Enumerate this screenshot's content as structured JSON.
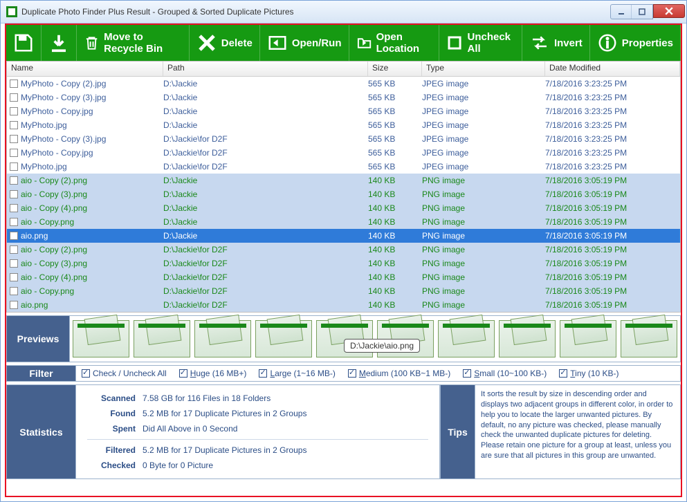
{
  "titlebar": {
    "text": "Duplicate Photo Finder Plus Result - Grouped & Sorted Duplicate Pictures"
  },
  "toolbar": {
    "recycle": "Move to Recycle Bin",
    "delete": "Delete",
    "open": "Open/Run",
    "location": "Open Location",
    "uncheck": "Uncheck All",
    "invert": "Invert",
    "properties": "Properties"
  },
  "columns": {
    "name": "Name",
    "path": "Path",
    "size": "Size",
    "type": "Type",
    "date": "Date Modified"
  },
  "rows": [
    {
      "g": 0,
      "name": "MyPhoto - Copy (2).jpg",
      "path": "D:\\Jackie",
      "size": "565 KB",
      "type": "JPEG image",
      "date": "7/18/2016 3:23:25 PM"
    },
    {
      "g": 0,
      "name": "MyPhoto - Copy (3).jpg",
      "path": "D:\\Jackie",
      "size": "565 KB",
      "type": "JPEG image",
      "date": "7/18/2016 3:23:25 PM"
    },
    {
      "g": 0,
      "name": "MyPhoto - Copy.jpg",
      "path": "D:\\Jackie",
      "size": "565 KB",
      "type": "JPEG image",
      "date": "7/18/2016 3:23:25 PM"
    },
    {
      "g": 0,
      "name": "MyPhoto.jpg",
      "path": "D:\\Jackie",
      "size": "565 KB",
      "type": "JPEG image",
      "date": "7/18/2016 3:23:25 PM"
    },
    {
      "g": 0,
      "name": "MyPhoto - Copy (3).jpg",
      "path": "D:\\Jackie\\for D2F",
      "size": "565 KB",
      "type": "JPEG image",
      "date": "7/18/2016 3:23:25 PM"
    },
    {
      "g": 0,
      "name": "MyPhoto - Copy.jpg",
      "path": "D:\\Jackie\\for D2F",
      "size": "565 KB",
      "type": "JPEG image",
      "date": "7/18/2016 3:23:25 PM"
    },
    {
      "g": 0,
      "name": "MyPhoto.jpg",
      "path": "D:\\Jackie\\for D2F",
      "size": "565 KB",
      "type": "JPEG image",
      "date": "7/18/2016 3:23:25 PM"
    },
    {
      "g": 1,
      "name": "aio - Copy (2).png",
      "path": "D:\\Jackie",
      "size": "140 KB",
      "type": "PNG image",
      "date": "7/18/2016 3:05:19 PM"
    },
    {
      "g": 1,
      "name": "aio - Copy (3).png",
      "path": "D:\\Jackie",
      "size": "140 KB",
      "type": "PNG image",
      "date": "7/18/2016 3:05:19 PM"
    },
    {
      "g": 1,
      "name": "aio - Copy (4).png",
      "path": "D:\\Jackie",
      "size": "140 KB",
      "type": "PNG image",
      "date": "7/18/2016 3:05:19 PM"
    },
    {
      "g": 1,
      "name": "aio - Copy.png",
      "path": "D:\\Jackie",
      "size": "140 KB",
      "type": "PNG image",
      "date": "7/18/2016 3:05:19 PM"
    },
    {
      "g": 1,
      "sel": true,
      "name": "aio.png",
      "path": "D:\\Jackie",
      "size": "140 KB",
      "type": "PNG image",
      "date": "7/18/2016 3:05:19 PM"
    },
    {
      "g": 1,
      "name": "aio - Copy (2).png",
      "path": "D:\\Jackie\\for D2F",
      "size": "140 KB",
      "type": "PNG image",
      "date": "7/18/2016 3:05:19 PM"
    },
    {
      "g": 1,
      "name": "aio - Copy (3).png",
      "path": "D:\\Jackie\\for D2F",
      "size": "140 KB",
      "type": "PNG image",
      "date": "7/18/2016 3:05:19 PM"
    },
    {
      "g": 1,
      "name": "aio - Copy (4).png",
      "path": "D:\\Jackie\\for D2F",
      "size": "140 KB",
      "type": "PNG image",
      "date": "7/18/2016 3:05:19 PM"
    },
    {
      "g": 1,
      "name": "aio - Copy.png",
      "path": "D:\\Jackie\\for D2F",
      "size": "140 KB",
      "type": "PNG image",
      "date": "7/18/2016 3:05:19 PM"
    },
    {
      "g": 1,
      "name": "aio.png",
      "path": "D:\\Jackie\\for D2F",
      "size": "140 KB",
      "type": "PNG image",
      "date": "7/18/2016 3:05:19 PM"
    }
  ],
  "tooltip": "D:\\Jackie\\aio.png",
  "panels": {
    "previews": "Previews",
    "filter": "Filter",
    "statistics": "Statistics",
    "tips": "Tips"
  },
  "filter": {
    "checkall": "Check / Uncheck All",
    "huge": "Huge (16 MB+)",
    "large": "Large (1~16 MB-)",
    "medium": "Medium (100 KB~1 MB-)",
    "small": "Small (10~100 KB-)",
    "tiny": "Tiny (10 KB-)"
  },
  "stats": {
    "scanned_lbl": "Scanned",
    "scanned": "7.58 GB for 116 Files in 18 Folders",
    "found_lbl": "Found",
    "found": "5.2 MB for 17 Duplicate Pictures in 2 Groups",
    "spent_lbl": "Spent",
    "spent": "Did All Above in 0 Second",
    "filtered_lbl": "Filtered",
    "filtered": "5.2 MB for 17 Duplicate Pictures in 2 Groups",
    "checked_lbl": "Checked",
    "checked": "0 Byte for 0 Picture"
  },
  "tips": "It sorts the result by size in descending order and displays two adjacent groups in different color, in order to help you to locate the larger unwanted pictures. By default, no any picture was checked, please manually check the unwanted duplicate pictures for deleting. Please retain one picture for a group at least, unless you are sure that all pictures in this group are unwanted."
}
